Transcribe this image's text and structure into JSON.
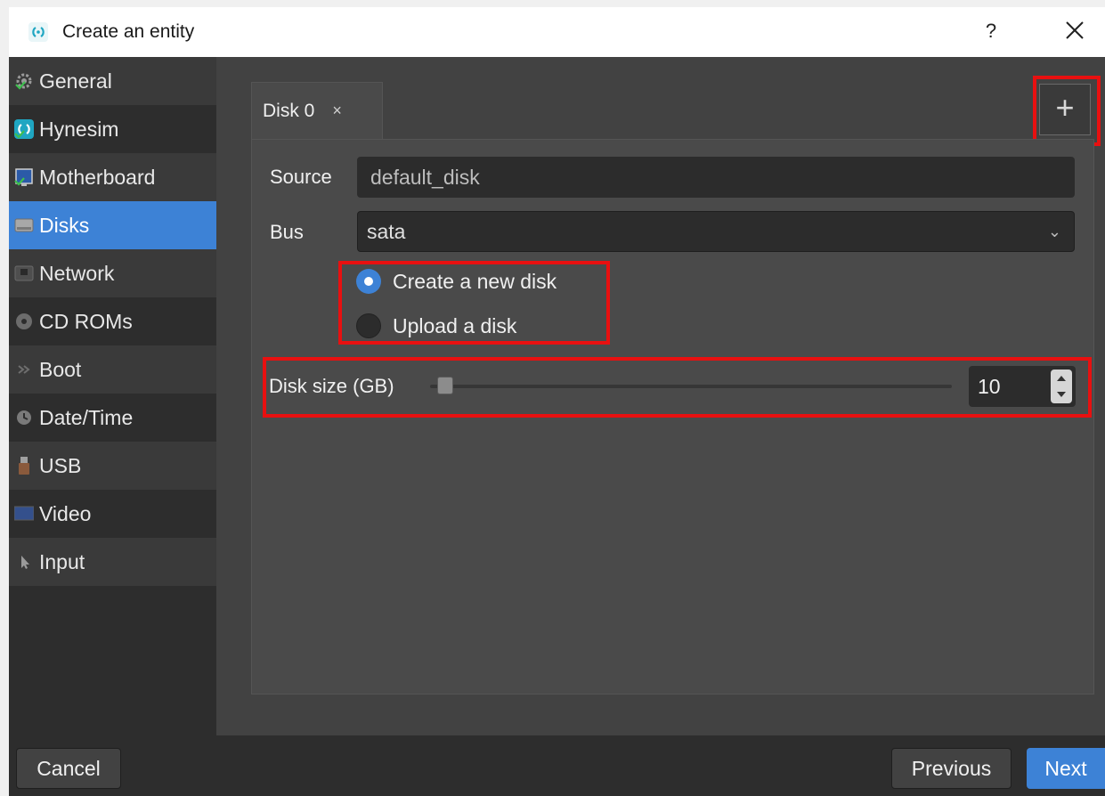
{
  "window": {
    "title": "Create an entity",
    "help_label": "?",
    "close_icon": "close-icon",
    "accent_color": "#3d82d6",
    "highlight_color": "#e81010"
  },
  "sidebar": {
    "items": [
      {
        "label": "General",
        "icon": "gear-icon",
        "selected": false
      },
      {
        "label": "Hynesim",
        "icon": "hynesim-logo-icon",
        "selected": false
      },
      {
        "label": "Motherboard",
        "icon": "motherboard-icon",
        "selected": false
      },
      {
        "label": "Disks",
        "icon": "disk-icon",
        "selected": true
      },
      {
        "label": "Network",
        "icon": "network-icon",
        "selected": false
      },
      {
        "label": "CD ROMs",
        "icon": "cdrom-icon",
        "selected": false
      },
      {
        "label": "Boot",
        "icon": "boot-icon",
        "selected": false
      },
      {
        "label": "Date/Time",
        "icon": "clock-icon",
        "selected": false
      },
      {
        "label": "USB",
        "icon": "usb-icon",
        "selected": false
      },
      {
        "label": "Video",
        "icon": "monitor-icon",
        "selected": false
      },
      {
        "label": "Input",
        "icon": "cursor-icon",
        "selected": false
      }
    ]
  },
  "tabs": [
    {
      "label": "Disk 0",
      "close_label": "×"
    }
  ],
  "add_button_label": "+",
  "form": {
    "source_label": "Source",
    "source_value": "default_disk",
    "bus_label": "Bus",
    "bus_value": "sata",
    "radio_options": [
      {
        "label": "Create a new disk",
        "checked": true
      },
      {
        "label": "Upload a disk",
        "checked": false
      }
    ],
    "disk_size_label": "Disk size (GB)",
    "disk_size_value": "10"
  },
  "footer": {
    "cancel_label": "Cancel",
    "previous_label": "Previous",
    "next_label": "Next"
  }
}
